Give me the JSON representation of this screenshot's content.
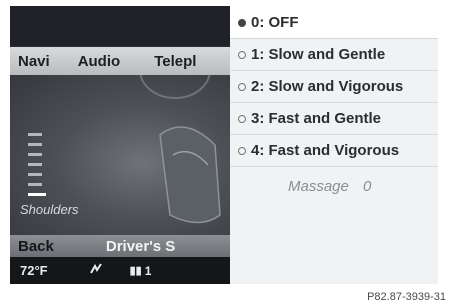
{
  "menubar": {
    "items": [
      "Navi",
      "Audio",
      "Telepl"
    ]
  },
  "seat_panel": {
    "label": "Shoulders",
    "levels_total": 7,
    "active_level": 7
  },
  "bottombar": {
    "back_label": "Back",
    "title": "Driver's S"
  },
  "statusbar": {
    "temperature": "72°F",
    "fan_icon": "seat-heating-icon",
    "channel": "1"
  },
  "dropdown": {
    "options": [
      {
        "label": "0: OFF",
        "selected": true
      },
      {
        "label": "1: Slow and Gentle",
        "selected": false
      },
      {
        "label": "2: Slow and Vigorous",
        "selected": false
      },
      {
        "label": "3: Fast and Gentle",
        "selected": false
      },
      {
        "label": "4: Fast and Vigorous",
        "selected": false
      }
    ],
    "massage_label": "Massage",
    "massage_value": "0"
  },
  "caption": "P82.87-3939-31"
}
